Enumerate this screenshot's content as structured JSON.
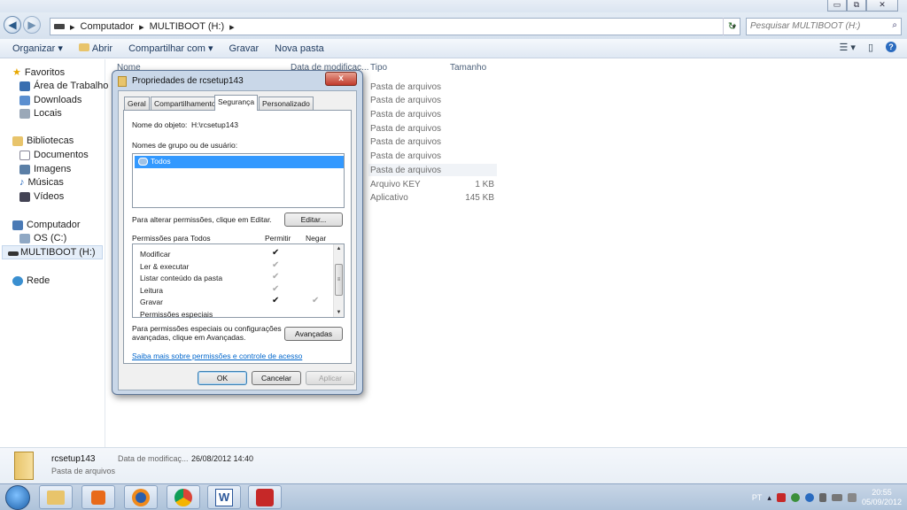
{
  "window": {
    "min": "▭",
    "max": "⧉",
    "close": "✕"
  },
  "address": {
    "back": "◀",
    "fwd": "▶",
    "seg1": "Computador",
    "seg2": "MULTIBOOT (H:)",
    "sep": "▸",
    "dropdown": "▾",
    "refresh": "↻"
  },
  "search": {
    "placeholder": "Pesquisar MULTIBOOT (H:)",
    "icon": "⌕"
  },
  "toolbar": {
    "organize": "Organizar ▾",
    "open": "Abrir",
    "share": "Compartilhar com ▾",
    "burn": "Gravar",
    "new_folder": "Nova pasta",
    "views": "☰ ▾",
    "preview": "▯",
    "help": "?"
  },
  "nav": {
    "favorites": "Favoritos",
    "desktop": "Área de Trabalho",
    "downloads": "Downloads",
    "places": "Locais",
    "libraries": "Bibliotecas",
    "documents": "Documentos",
    "images": "Imagens",
    "music": "Músicas",
    "videos": "Vídeos",
    "computer": "Computador",
    "os": "OS (C:)",
    "multiboot": "MULTIBOOT (H:)",
    "network": "Rede"
  },
  "columns": {
    "name": "Nome",
    "date": "Data de modificaç...",
    "type": "Tipo",
    "size": "Tamanho"
  },
  "rows": [
    {
      "type": "Pasta de arquivos",
      "size": ""
    },
    {
      "type": "Pasta de arquivos",
      "size": ""
    },
    {
      "type": "Pasta de arquivos",
      "size": ""
    },
    {
      "type": "Pasta de arquivos",
      "size": ""
    },
    {
      "type": "Pasta de arquivos",
      "size": ""
    },
    {
      "type": "Pasta de arquivos",
      "size": ""
    },
    {
      "type": "Pasta de arquivos",
      "size": ""
    },
    {
      "type": "Arquivo KEY",
      "size": "1 KB"
    },
    {
      "type": "Aplicativo",
      "size": "145 KB"
    }
  ],
  "details": {
    "name": "rcsetup143",
    "kind": "Pasta de arquivos",
    "date_label": "Data de modificaç...",
    "date": "26/08/2012 14:40"
  },
  "dialog": {
    "title": "Propriedades de rcsetup143",
    "close": "x",
    "tabs": [
      "Geral",
      "Compartilhamento",
      "Segurança",
      "Personalizado"
    ],
    "object_label": "Nome do objeto:",
    "object_value": "H:\\rcsetup143",
    "group_label": "Nomes de grupo ou de usuário:",
    "group_item": "Todos",
    "change_text": "Para alterar permissões, clique em Editar.",
    "edit": "Editar...",
    "perm_title": "Permissões para Todos",
    "allow": "Permitir",
    "deny": "Negar",
    "permissions": [
      {
        "name": "Modificar",
        "allow": "✔",
        "deny": ""
      },
      {
        "name": "Ler & executar",
        "allow": "✔",
        "deny": ""
      },
      {
        "name": "Listar conteúdo da pasta",
        "allow": "✔",
        "deny": ""
      },
      {
        "name": "Leitura",
        "allow": "✔",
        "deny": ""
      },
      {
        "name": "Gravar",
        "allow": "✔",
        "deny": "✔"
      },
      {
        "name": "Permissões especiais",
        "allow": "",
        "deny": ""
      }
    ],
    "special_text1": "Para permissões especiais ou configurações",
    "special_text2": "avançadas, clique em Avançadas.",
    "advanced": "Avançadas",
    "learn_link": "Saiba mais sobre permissões e controle de acesso",
    "ok": "OK",
    "cancel": "Cancelar",
    "apply": "Aplicar",
    "scroll_up": "▲",
    "scroll_down": "▼",
    "scroll_grip": "≡"
  },
  "taskbar": {
    "lang": "PT",
    "tray_arrow": "▴",
    "time": "20:55",
    "date": "05/09/2012",
    "word": "W"
  }
}
